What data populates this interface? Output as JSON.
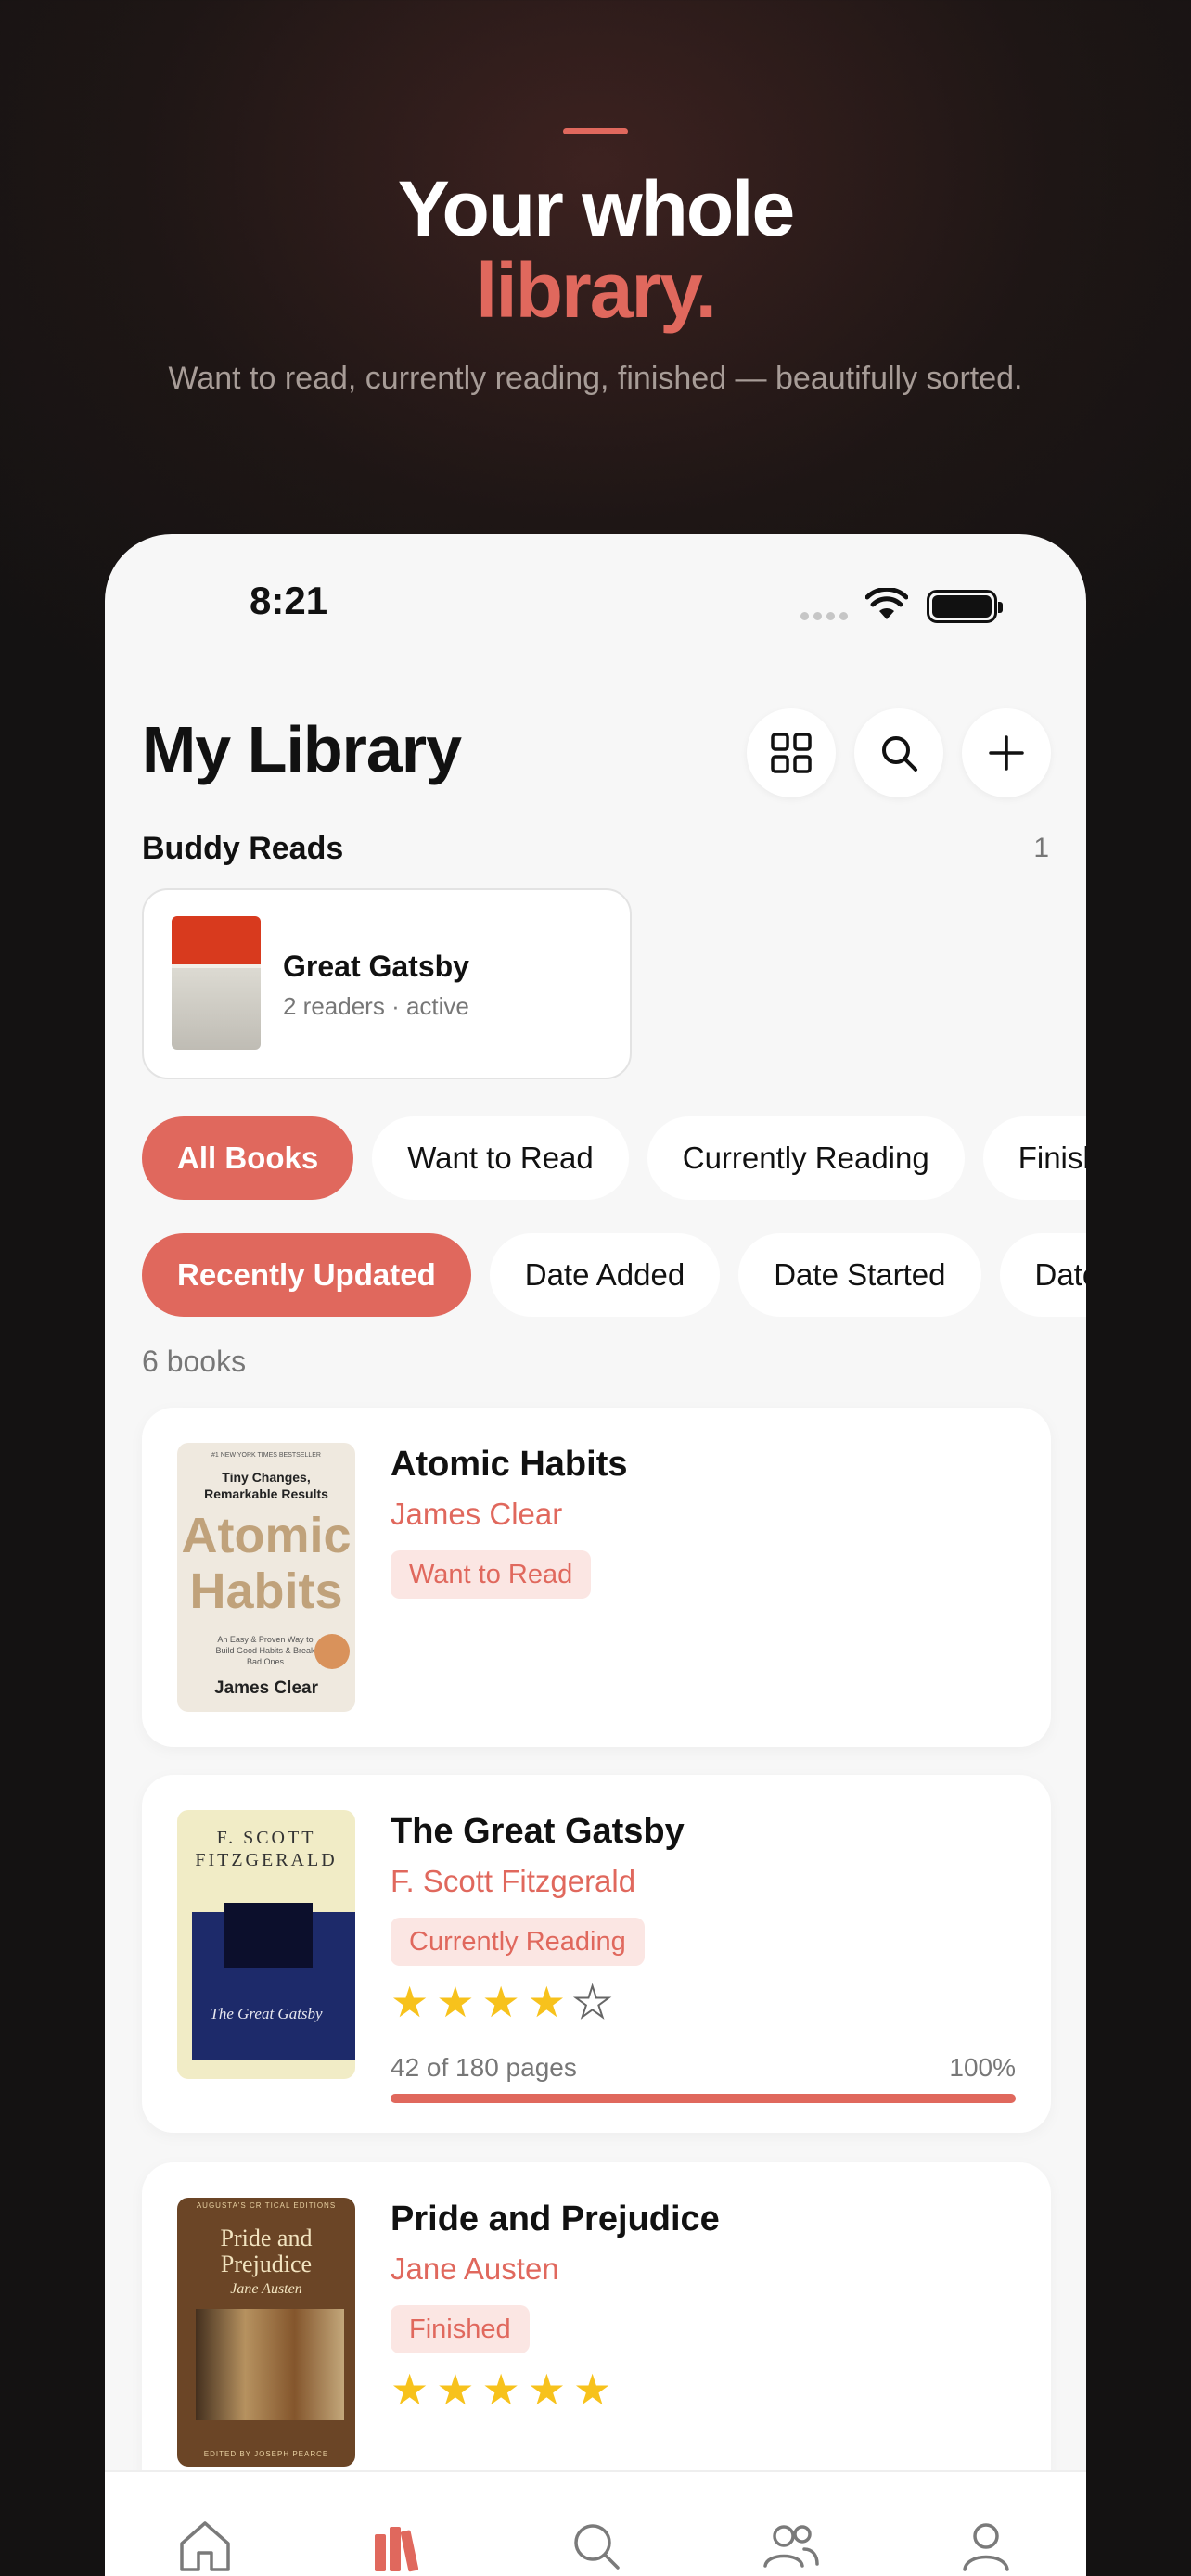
{
  "promo": {
    "title_line1": "Your whole",
    "title_line2": "library.",
    "subtitle": "Want to read, currently reading, finished — beautifully sorted."
  },
  "status_bar": {
    "time": "8:21"
  },
  "header": {
    "title": "My Library"
  },
  "buddy_reads": {
    "label": "Buddy Reads",
    "count": "1",
    "card": {
      "title": "Great Gatsby",
      "meta": "2 readers · active"
    }
  },
  "filters": [
    {
      "label": "All Books",
      "active": true
    },
    {
      "label": "Want to Read",
      "active": false
    },
    {
      "label": "Currently Reading",
      "active": false
    },
    {
      "label": "Finished",
      "active": false
    }
  ],
  "sorts": [
    {
      "label": "Recently Updated",
      "active": true
    },
    {
      "label": "Date Added",
      "active": false
    },
    {
      "label": "Date Started",
      "active": false
    },
    {
      "label": "Date Finished",
      "active": false
    }
  ],
  "book_count": "6 books",
  "books": [
    {
      "title": "Atomic Habits",
      "author": "James Clear",
      "status": "Want to Read",
      "cover": {
        "top_line": "#1 NEW YORK TIMES BESTSELLER",
        "tagline": "Tiny Changes, Remarkable Results",
        "title": "Atomic Habits",
        "desc": "An Easy & Proven Way to Build Good Habits & Break Bad Ones",
        "author": "James Clear"
      }
    },
    {
      "title": "The Great Gatsby",
      "author": "F. Scott Fitzgerald",
      "status": "Currently Reading",
      "rating": 4,
      "progress_text": "42 of 180 pages",
      "progress_pct_text": "100%",
      "progress_fraction": 1.0,
      "cover": {
        "author": "F. SCOTT FITZGERALD",
        "title": "The Great Gatsby"
      }
    },
    {
      "title": "Pride and Prejudice",
      "author": "Jane Austen",
      "status": "Finished",
      "rating": 5,
      "cover": {
        "top_line": "AUGUSTA'S CRITICAL EDITIONS",
        "title": "Pride and Prejudice",
        "author": "Jane Austen",
        "editor": "EDITED BY JOSEPH PEARCE"
      }
    }
  ],
  "tabs": [
    "home-icon",
    "library-icon",
    "search-icon",
    "friends-icon",
    "profile-icon"
  ],
  "colors": {
    "accent": "#e0685d",
    "star": "#f7c21c",
    "background": "#f7f7f7"
  }
}
